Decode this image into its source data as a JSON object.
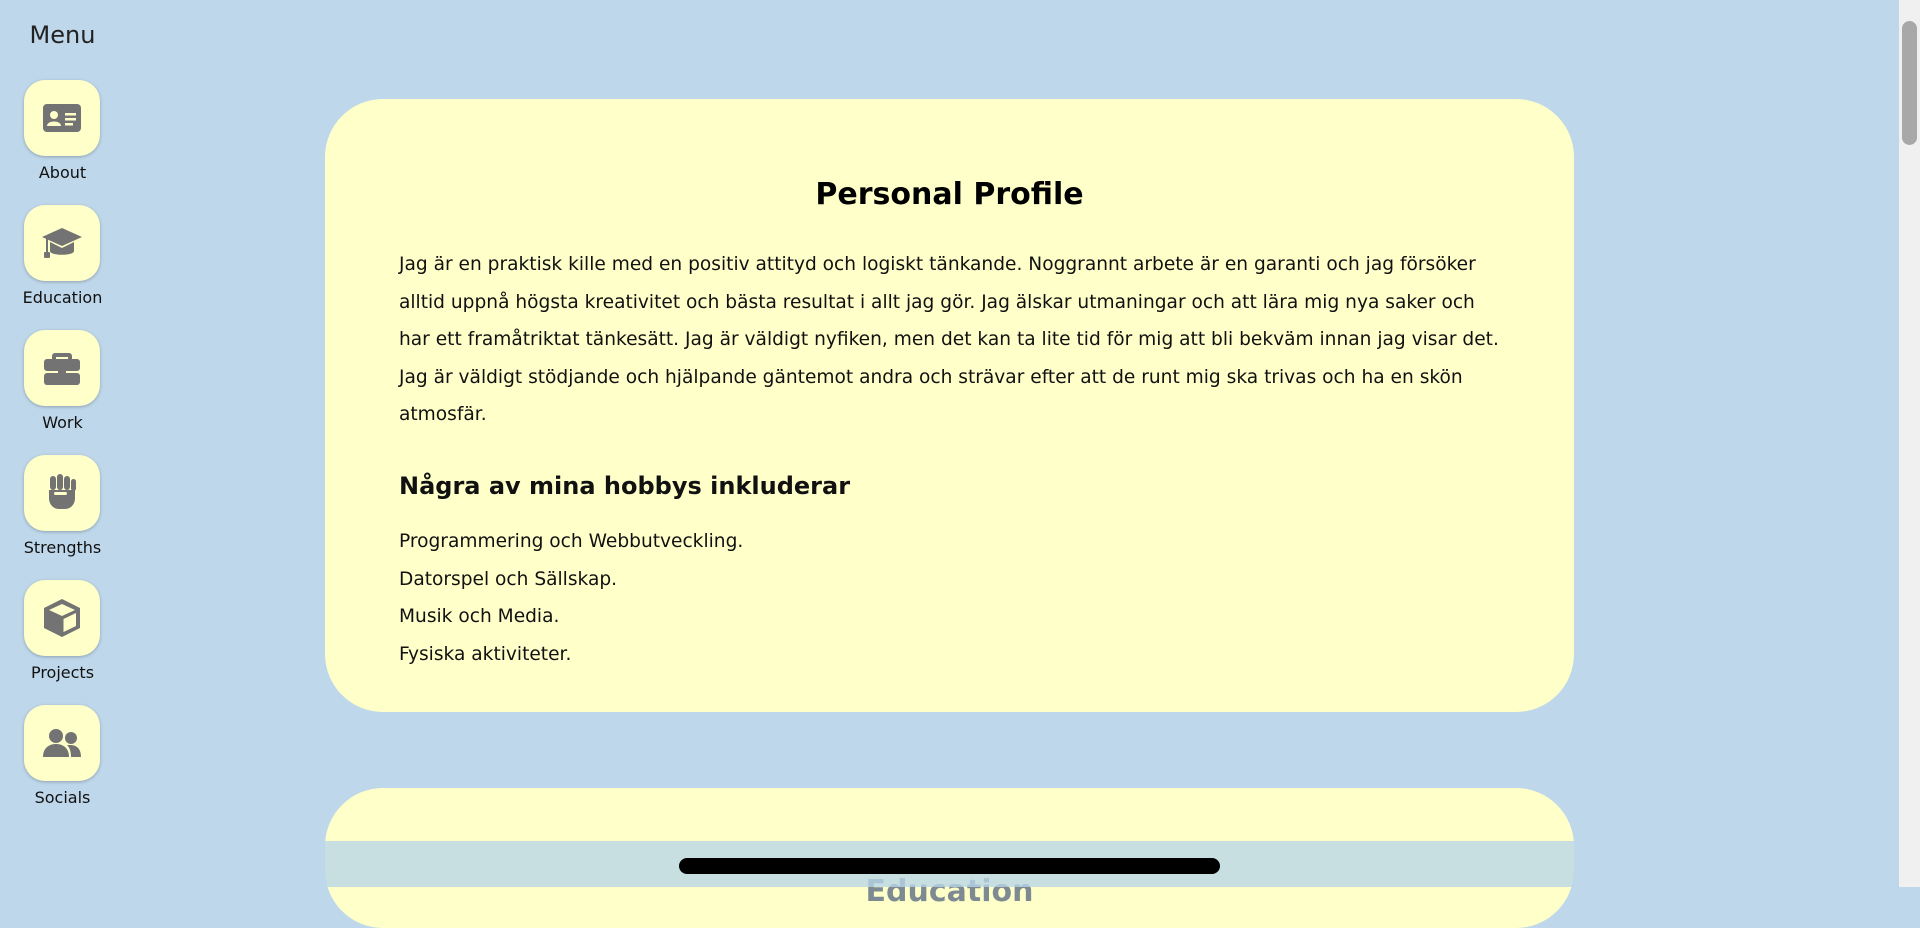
{
  "sidebar": {
    "title": "Menu",
    "items": [
      {
        "label": "About",
        "icon": "id-card-icon"
      },
      {
        "label": "Education",
        "icon": "graduation-cap-icon"
      },
      {
        "label": "Work",
        "icon": "briefcase-icon"
      },
      {
        "label": "Strengths",
        "icon": "fist-icon"
      },
      {
        "label": "Projects",
        "icon": "cube-icon"
      },
      {
        "label": "Socials",
        "icon": "users-icon"
      }
    ]
  },
  "profile": {
    "title": "Personal Profile",
    "description": "Jag är en praktisk kille med en positiv attityd och logiskt tänkande. Noggrannt arbete är en garanti och jag försöker alltid uppnå högsta kreativitet och bästa resultat i allt jag gör. Jag älskar utmaningar och att lära mig nya saker och har ett framåtriktat tänkesätt. Jag är väldigt nyfiken, men det kan ta lite tid för mig att bli bekväm innan jag visar det. Jag är väldigt stödjande och hjälpande gäntemot andra och strävar efter att de runt mig ska trivas och ha en skön atmosfär.",
    "hobbies_heading": "Några av mina hobbys inkluderar",
    "hobbies": [
      "Programmering och Webbutveckling.",
      "Datorspel och Sällskap.",
      "Musik och Media.",
      "Fysiska aktiviteter."
    ]
  },
  "education": {
    "title": "Education"
  },
  "colors": {
    "background": "#bed7ea",
    "card": "#ffffca",
    "icon": "#737373"
  }
}
